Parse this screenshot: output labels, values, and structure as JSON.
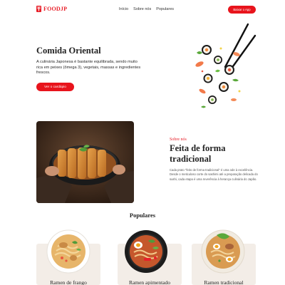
{
  "brand": {
    "name": "FOODJP",
    "color": "#e8202a"
  },
  "nav": {
    "links": [
      "Início",
      "Sobre nós",
      "Populares"
    ],
    "cta": "Baixar o App"
  },
  "hero": {
    "title": "Comida Oriental",
    "description": "A culinária Japonesa é bastante equilibrada, sendo muito rica em peixes (ômega 3), vegetais, massas e ingredientes frescos.",
    "button": "Ver o cardápio",
    "image_icon": "flying-sushi-with-chopsticks"
  },
  "about": {
    "kicker": "Sobre nós",
    "title": "Feita de forma tradicional",
    "description": "Cada prato \"feito de forma tradicional\" é uma ode à excelência. Desde o meticuloso corte do sashimi até a preparação delicada do sushi, cada etapa é uma reverência à herança culinária do Japão.",
    "image_icon": "katsu-rice-bowl-photo"
  },
  "popular": {
    "title": "Populares",
    "items": [
      {
        "name": "Ramen de frango",
        "image_icon": "chicken-ramen-bowl"
      },
      {
        "name": "Ramen apimentado",
        "image_icon": "spicy-ramen-bowl"
      },
      {
        "name": "Ramen tradicional",
        "image_icon": "traditional-ramen-bowl"
      }
    ]
  }
}
